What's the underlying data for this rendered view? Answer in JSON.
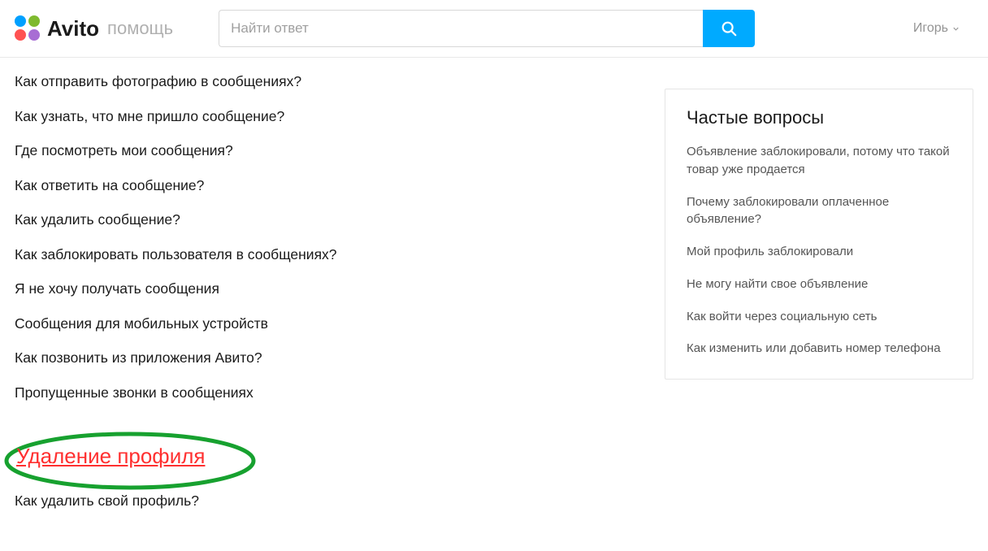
{
  "header": {
    "brand": "Avito",
    "brand_sub": "помощь",
    "search_placeholder": "Найти ответ",
    "user_name": "Игорь"
  },
  "main": {
    "faq_items": [
      "Как отправить фотографию в сообщениях?",
      "Как узнать, что мне пришло сообщение?",
      "Где посмотреть мои сообщения?",
      "Как ответить на сообщение?",
      "Как удалить сообщение?",
      "Как заблокировать пользователя в сообщениях?",
      "Я не хочу получать сообщения",
      "Сообщения для мобильных устройств",
      "Как позвонить из приложения Авито?",
      "Пропущенные звонки в сообщениях"
    ],
    "highlighted_section": "Удаление профиля",
    "section_items": [
      "Как удалить свой профиль?"
    ]
  },
  "sidebar": {
    "title": "Частые вопросы",
    "items": [
      "Объявление заблокировали, потому что такой товар уже продается",
      "Почему заблокировали оплаченное объявление?",
      "Мой профиль заблокировали",
      "Не могу найти свое объявление",
      "Как войти через социальную сеть",
      "Как изменить или добавить номер телефона"
    ]
  }
}
